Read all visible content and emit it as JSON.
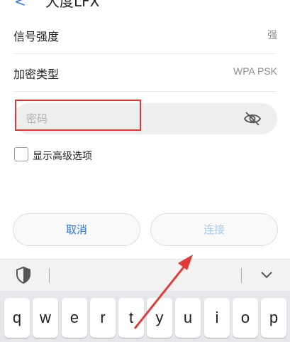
{
  "header": {
    "title": "大度LFX"
  },
  "info_rows": [
    {
      "label": "信号强度",
      "value": "强"
    },
    {
      "label": "加密类型",
      "value": "WPA PSK"
    }
  ],
  "password": {
    "placeholder": "密码",
    "value": ""
  },
  "advanced": {
    "label": "显示高级选项",
    "checked": false
  },
  "buttons": {
    "cancel": "取消",
    "connect": "连接"
  },
  "keyboard": {
    "keys": [
      "q",
      "w",
      "e",
      "r",
      "t",
      "y",
      "u",
      "i",
      "o",
      "p"
    ]
  },
  "colors": {
    "accent": "#2a70d8",
    "highlight": "#e23b35"
  }
}
